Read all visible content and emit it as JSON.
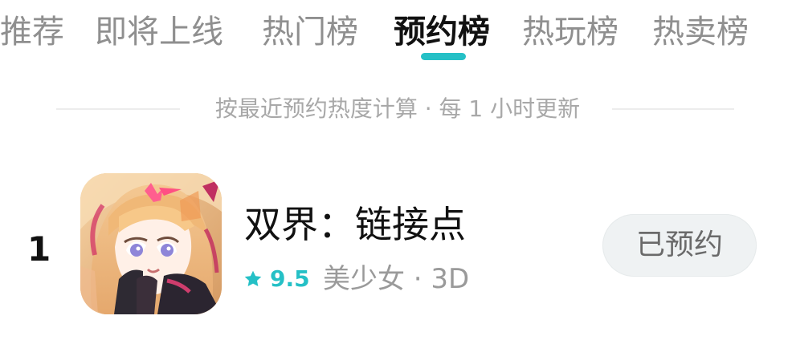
{
  "tabs": [
    {
      "label": "推荐",
      "active": false
    },
    {
      "label": "即将上线",
      "active": false
    },
    {
      "label": "热门榜",
      "active": false
    },
    {
      "label": "预约榜",
      "active": true
    },
    {
      "label": "热玩榜",
      "active": false
    },
    {
      "label": "热卖榜",
      "active": false
    }
  ],
  "accent_color": "#25c0c6",
  "note": "按最近预约热度计算 · 每 1 小时更新",
  "items": [
    {
      "rank": "1",
      "title": "双界：链接点",
      "rating": "9.5",
      "tags": "美少女 · 3D",
      "button_label": "已预约",
      "icon": "app-icon-anime-girl"
    }
  ]
}
